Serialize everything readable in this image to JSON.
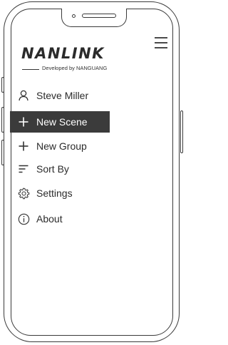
{
  "brand": {
    "logo_text": "NANLINK",
    "tagline": "Developed by NANGUANG"
  },
  "menu": {
    "items": [
      {
        "label": "Steve Miller",
        "icon": "person-icon",
        "active": false
      },
      {
        "label": "New Scene",
        "icon": "plus-icon",
        "active": true
      },
      {
        "label": "New Group",
        "icon": "plus-icon",
        "active": false
      },
      {
        "label": "Sort By",
        "icon": "sort-icon",
        "active": false
      },
      {
        "label": "Settings",
        "icon": "gear-icon",
        "active": false
      },
      {
        "label": "About",
        "icon": "info-icon",
        "active": false
      }
    ]
  },
  "colors": {
    "active_background": "#3b3b3b",
    "active_text": "#ffffff",
    "text": "#2b2b2b",
    "frame": "#3a3a3a"
  }
}
